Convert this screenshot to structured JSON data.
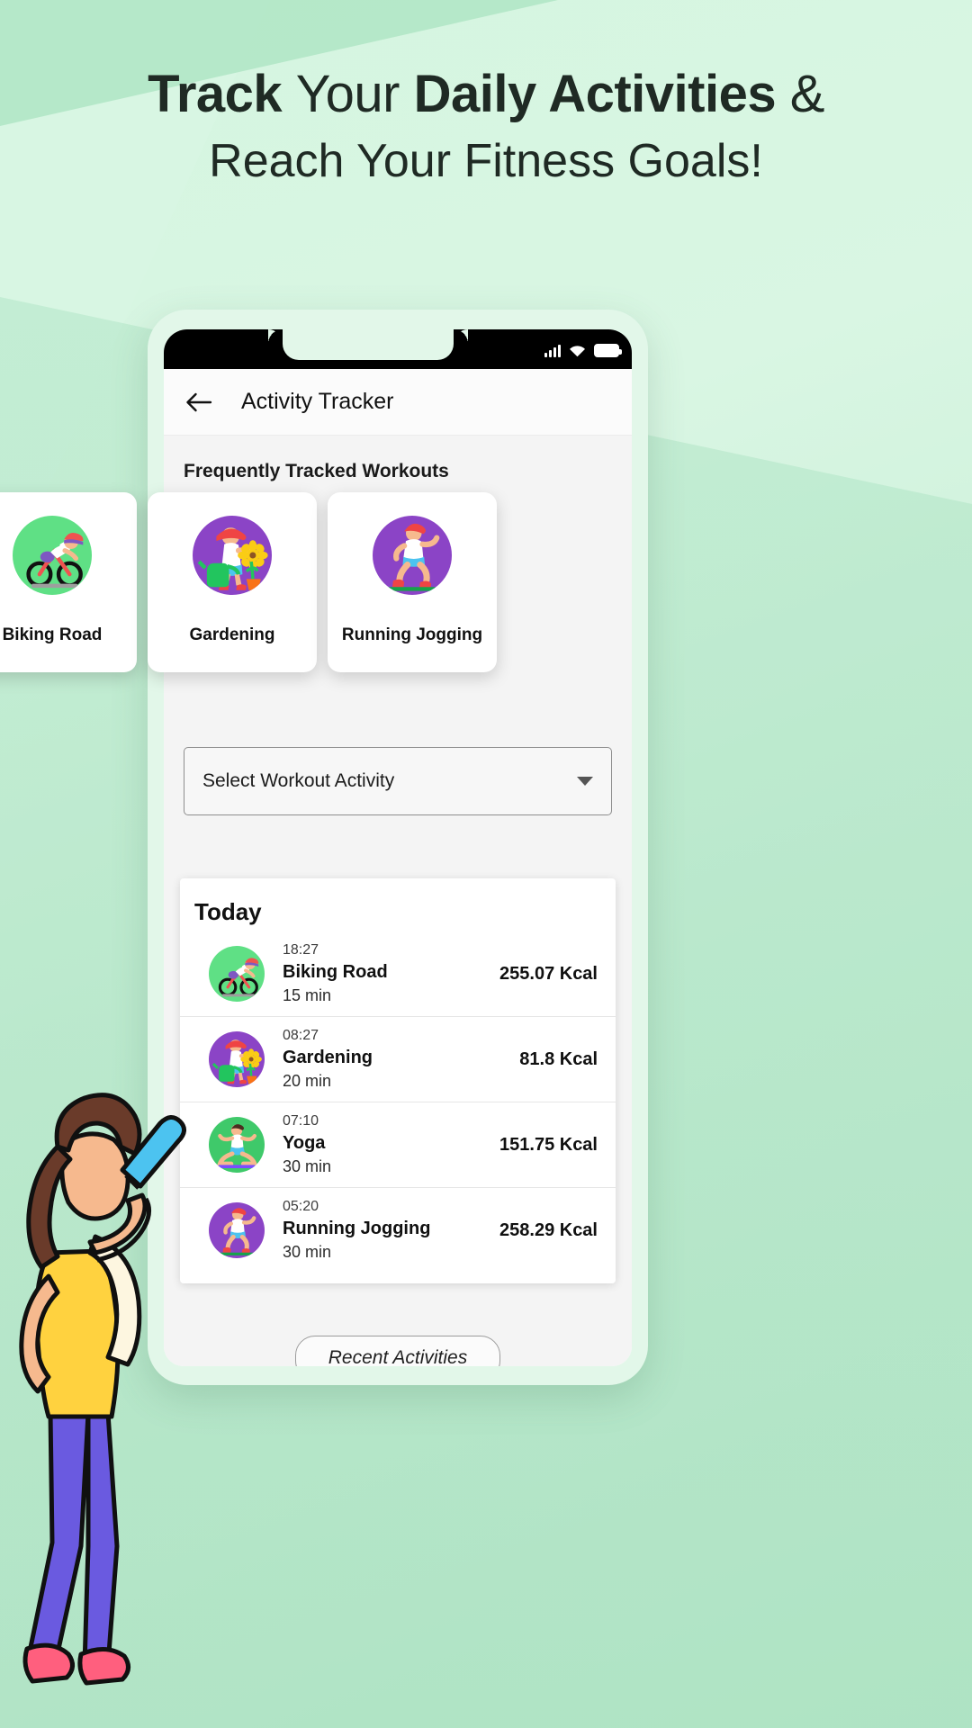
{
  "promo": {
    "line1_part1": "Track ",
    "line1_part2": "Your ",
    "line1_part3": "Daily Activities ",
    "line1_part4": "&",
    "line2": "Reach Your Fitness Goals!"
  },
  "statusbar": {
    "signal_icon": "cellular-signal-icon",
    "wifi_icon": "wifi-icon",
    "battery_icon": "battery-full-icon"
  },
  "appbar": {
    "back_icon": "back-arrow-icon",
    "title": "Activity Tracker"
  },
  "section": {
    "frequent_title": "Frequently Tracked Workouts"
  },
  "workout_cards": [
    {
      "label": "Biking Road",
      "icon": "cyclist-icon",
      "circle_color": "#5fe085"
    },
    {
      "label": "Gardening",
      "icon": "gardening-icon",
      "circle_color": "#8b44c6"
    },
    {
      "label": "Running Jogging",
      "icon": "runner-icon",
      "circle_color": "#8b44c6"
    }
  ],
  "select": {
    "value": "Select Workout Activity",
    "caret_icon": "chevron-down-icon"
  },
  "today": {
    "title": "Today",
    "rows": [
      {
        "time": "18:27",
        "name": "Biking Road",
        "duration": "15 min",
        "kcal": "255.07 Kcal",
        "icon": "cyclist-icon",
        "circle_color": "#5fe085"
      },
      {
        "time": "08:27",
        "name": "Gardening",
        "duration": "20 min",
        "kcal": "81.8 Kcal",
        "icon": "gardening-icon",
        "circle_color": "#8b44c6"
      },
      {
        "time": "07:10",
        "name": "Yoga",
        "duration": "30 min",
        "kcal": "151.75 Kcal",
        "icon": "yoga-icon",
        "circle_color": "#3fc96a"
      },
      {
        "time": "05:20",
        "name": "Running Jogging",
        "duration": "30 min",
        "kcal": "258.29 Kcal",
        "icon": "runner-icon",
        "circle_color": "#8b44c6"
      }
    ]
  },
  "footer": {
    "recent_label": "Recent Activities"
  },
  "navbar": {
    "back_icon": "nav-back-triangle-icon",
    "home_icon": "nav-home-circle-icon",
    "recents_icon": "nav-recents-square-icon"
  },
  "illustration": {
    "name": "woman-drinking-water-illustration"
  },
  "colors": {
    "background": "#cdf0da",
    "accent_green": "#5fe085",
    "accent_purple": "#8b44c6",
    "text_dark": "#1f2a24"
  }
}
